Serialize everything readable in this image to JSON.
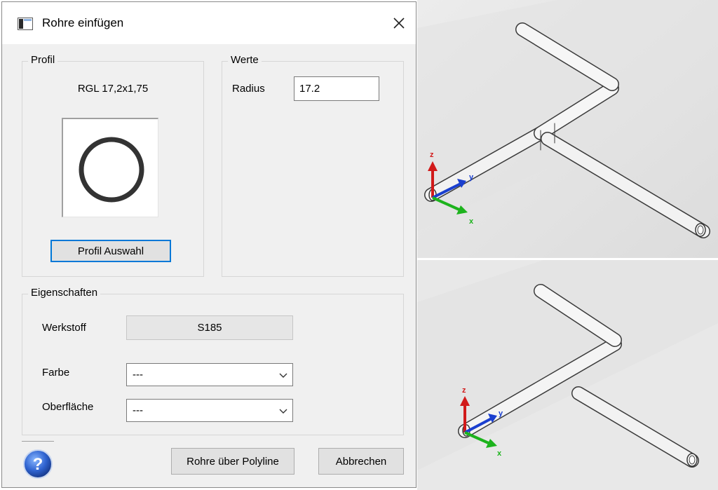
{
  "dialog": {
    "title": "Rohre einfügen",
    "profile_group": {
      "label": "Profil",
      "profile_name": "RGL 17,2x1,75",
      "select_button": "Profil Auswahl"
    },
    "values_group": {
      "label": "Werte",
      "radius_label": "Radius",
      "radius_value": "17.2"
    },
    "properties_group": {
      "label": "Eigenschaften",
      "material_label": "Werkstoff",
      "material_value": "S185",
      "color_label": "Farbe",
      "color_value": "---",
      "surface_label": "Oberfläche",
      "surface_value": "---"
    },
    "buttons": {
      "polyline": "Rohre über Polyline",
      "cancel": "Abbrechen"
    },
    "icons": [
      "window-icon",
      "close-icon",
      "help-icon",
      "chevron-down-icon"
    ]
  },
  "viewports": {
    "axis_labels": {
      "x": "x",
      "y": "y",
      "z": "z"
    },
    "colors": {
      "x_axis": "#1db31d",
      "y_axis": "#1a3fcf",
      "z_axis": "#d11a1a",
      "background": "#e6e6e6"
    }
  }
}
